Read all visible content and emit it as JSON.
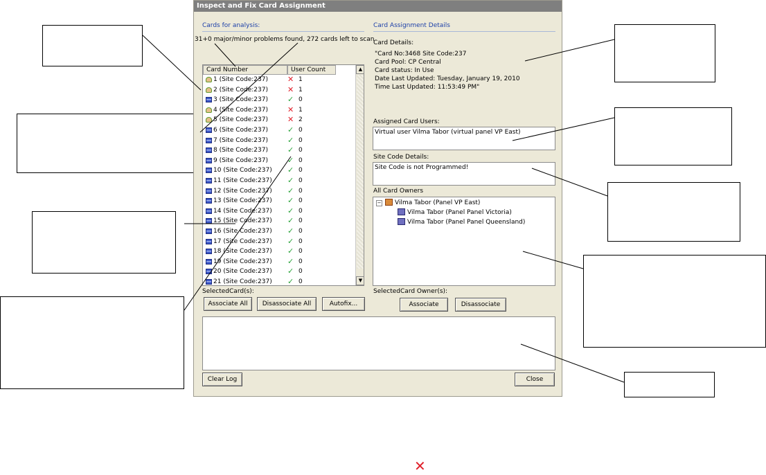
{
  "dialog": {
    "title": "Inspect and Fix Card Assignment",
    "cards_section": "Cards for analysis:",
    "status_text": "31+0 major/minor problems found, 272 cards left to scan",
    "columns": [
      "Card Number",
      "User Count"
    ],
    "rows": [
      {
        "label": "1 (Site Code:237)",
        "icon": "user-icon",
        "status": "error",
        "count": "1"
      },
      {
        "label": "2 (Site Code:237)",
        "icon": "user-icon",
        "status": "error",
        "count": "1"
      },
      {
        "label": "3 (Site Code:237)",
        "icon": "card-icon",
        "status": "ok",
        "count": "0"
      },
      {
        "label": "4 (Site Code:237)",
        "icon": "user-icon",
        "status": "error",
        "count": "1"
      },
      {
        "label": "5 (Site Code:237)",
        "icon": "user-icon",
        "status": "error",
        "count": "2"
      },
      {
        "label": "6 (Site Code:237)",
        "icon": "card-icon",
        "status": "ok",
        "count": "0"
      },
      {
        "label": "7 (Site Code:237)",
        "icon": "card-icon",
        "status": "ok",
        "count": "0"
      },
      {
        "label": "8 (Site Code:237)",
        "icon": "card-icon",
        "status": "ok",
        "count": "0"
      },
      {
        "label": "9 (Site Code:237)",
        "icon": "card-icon",
        "status": "ok",
        "count": "0"
      },
      {
        "label": "10 (Site Code:237)",
        "icon": "card-icon",
        "status": "ok",
        "count": "0"
      },
      {
        "label": "11 (Site Code:237)",
        "icon": "card-icon",
        "status": "ok",
        "count": "0"
      },
      {
        "label": "12 (Site Code:237)",
        "icon": "card-icon",
        "status": "ok",
        "count": "0"
      },
      {
        "label": "13 (Site Code:237)",
        "icon": "card-icon",
        "status": "ok",
        "count": "0"
      },
      {
        "label": "14 (Site Code:237)",
        "icon": "card-icon",
        "status": "ok",
        "count": "0"
      },
      {
        "label": "15 (Site Code:237)",
        "icon": "card-icon",
        "status": "ok",
        "count": "0"
      },
      {
        "label": "16 (Site Code:237)",
        "icon": "card-icon",
        "status": "ok",
        "count": "0"
      },
      {
        "label": "17 (Site Code:237)",
        "icon": "card-icon",
        "status": "ok",
        "count": "0"
      },
      {
        "label": "18 (Site Code:237)",
        "icon": "card-icon",
        "status": "ok",
        "count": "0"
      },
      {
        "label": "19 (Site Code:237)",
        "icon": "card-icon",
        "status": "ok",
        "count": "0"
      },
      {
        "label": "20 (Site Code:237)",
        "icon": "card-icon",
        "status": "ok",
        "count": "0"
      },
      {
        "label": "21 (Site Code:237)",
        "icon": "card-icon",
        "status": "ok",
        "count": "0"
      }
    ],
    "selected_cards_label": "SelectedCard(s):",
    "associate_all": "Associate All",
    "disassociate_all": "Disassociate All",
    "autofix": "Autofix...",
    "details_section": "Card Assignment Details",
    "card_details_label": "Card Details:",
    "card_details_lines": [
      "\"Card No:3468 Site Code:237",
      "Card Pool: CP Central",
      "Card status: In Use",
      "Date Last Updated: Tuesday, January 19, 2010",
      "Time Last Updated: 11:53:49 PM\""
    ],
    "assigned_users_label": "Assigned Card Users:",
    "assigned_users_value": "Virtual user Vilma Tabor (virtual panel VP East)",
    "site_code_label": "Site Code Details:",
    "site_code_value": "Site Code is not Programmed!",
    "owners_label": "All Card Owners",
    "owners_tree": {
      "root": "Vilma Tabor (Panel VP East)",
      "children": [
        "Vilma Tabor (Panel Panel Victoria)",
        "Vilma Tabor (Panel Panel Queensland)"
      ]
    },
    "selected_owners_label": "SelectedCard Owner(s):",
    "associate": "Associate",
    "disassociate": "Disassociate",
    "clear_log": "Clear Log",
    "close": "Close"
  },
  "colors": {
    "error": "#e0202a",
    "ok": "#2aa43a",
    "title_bar": "#7f7f7f",
    "section_heading": "#1c3fa8"
  }
}
